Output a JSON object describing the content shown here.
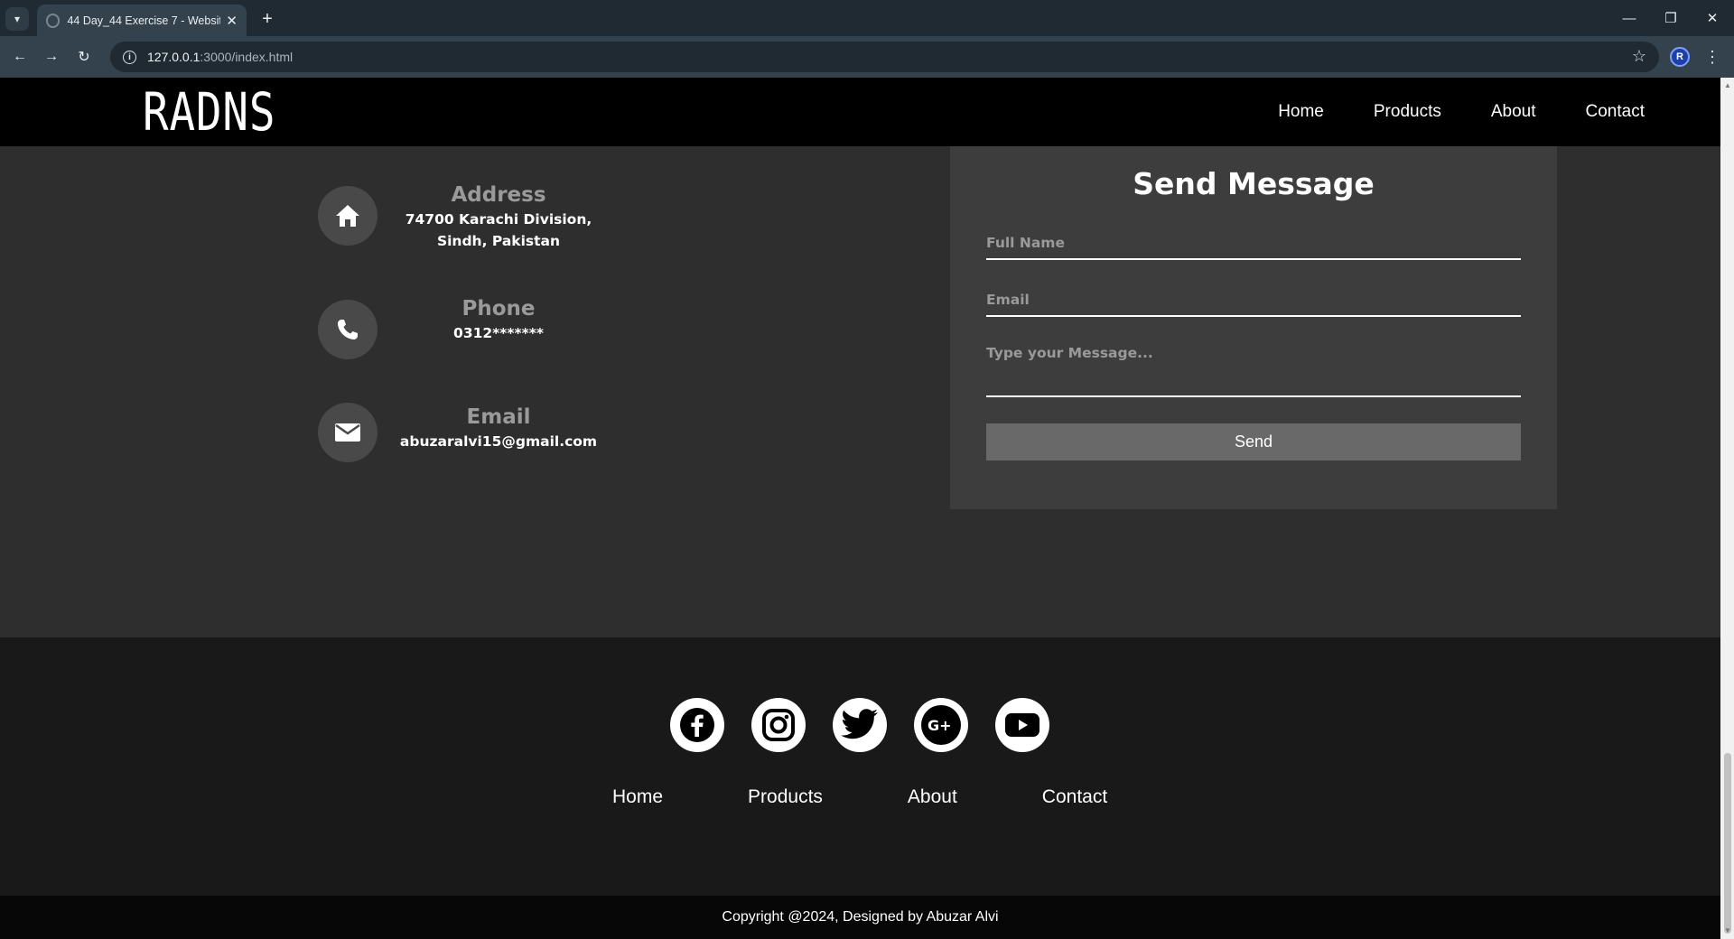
{
  "browser": {
    "tab_title": "44 Day_44 Exercise 7 - Website",
    "url_host": "127.0.0.1",
    "url_path": ":3000/index.html",
    "profile_initial": "R"
  },
  "header": {
    "logo": "RADNS",
    "nav": [
      "Home",
      "Products",
      "About",
      "Contact"
    ]
  },
  "contact_info": {
    "address": {
      "title": "Address",
      "line1": "74700 Karachi Division,",
      "line2": "Sindh, Pakistan",
      "icon": "home-icon"
    },
    "phone": {
      "title": "Phone",
      "value": "0312*******",
      "icon": "phone-icon"
    },
    "email": {
      "title": "Email",
      "value": "abuzaralvi15@gmail.com",
      "icon": "mail-icon"
    }
  },
  "form": {
    "title": "Send Message",
    "full_name_placeholder": "Full Name",
    "email_placeholder": "Email",
    "message_placeholder": "Type your Message...",
    "send_label": "Send"
  },
  "footer": {
    "social": [
      "facebook-icon",
      "instagram-icon",
      "twitter-icon",
      "google-plus-icon",
      "youtube-icon"
    ],
    "nav": [
      "Home",
      "Products",
      "About",
      "Contact"
    ],
    "copyright": "Copyright @2024, Designed by Abuzar Alvi"
  },
  "colors": {
    "page_bg": "#2e2e2e",
    "header_bg": "#000000",
    "panel_bg": "#3d3d3d",
    "footer_bg": "#191919",
    "button_bg": "#696969",
    "muted_text": "#9a9a9a"
  }
}
